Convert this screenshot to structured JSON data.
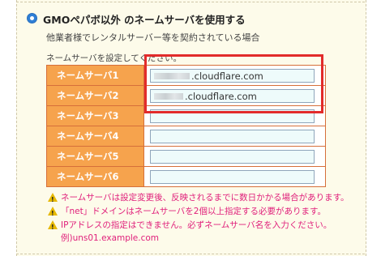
{
  "option": {
    "label": "GMOペパボ以外 のネームサーバを使用する",
    "subtext": "他業者様でレンタルサーバー等を契約されている場合"
  },
  "instruction": "ネームサーバを設定してください。",
  "nameservers": [
    {
      "label": "ネームサーバ1",
      "value": ".cloudflare.com"
    },
    {
      "label": "ネームサーバ2",
      "value": ".cloudflare.com"
    },
    {
      "label": "ネームサーバ3",
      "value": ""
    },
    {
      "label": "ネームサーバ4",
      "value": ""
    },
    {
      "label": "ネームサーバ5",
      "value": ""
    },
    {
      "label": "ネームサーバ6",
      "value": ""
    }
  ],
  "warnings": [
    "ネームサーバは設定変更後、反映されるまでに数日かかる場合があります。",
    "「net」ドメインはネームサーバを2個以上指定する必要があります。",
    "IPアドレスの指定はできません。必ずネームサーバ名を入力ください。"
  ],
  "example": "例)uns01.example.com",
  "colors": {
    "label_bg": "#f6a34d",
    "highlight": "#e22b2b",
    "warning_text": "#e0207b",
    "radio": "#2f7fd6"
  }
}
